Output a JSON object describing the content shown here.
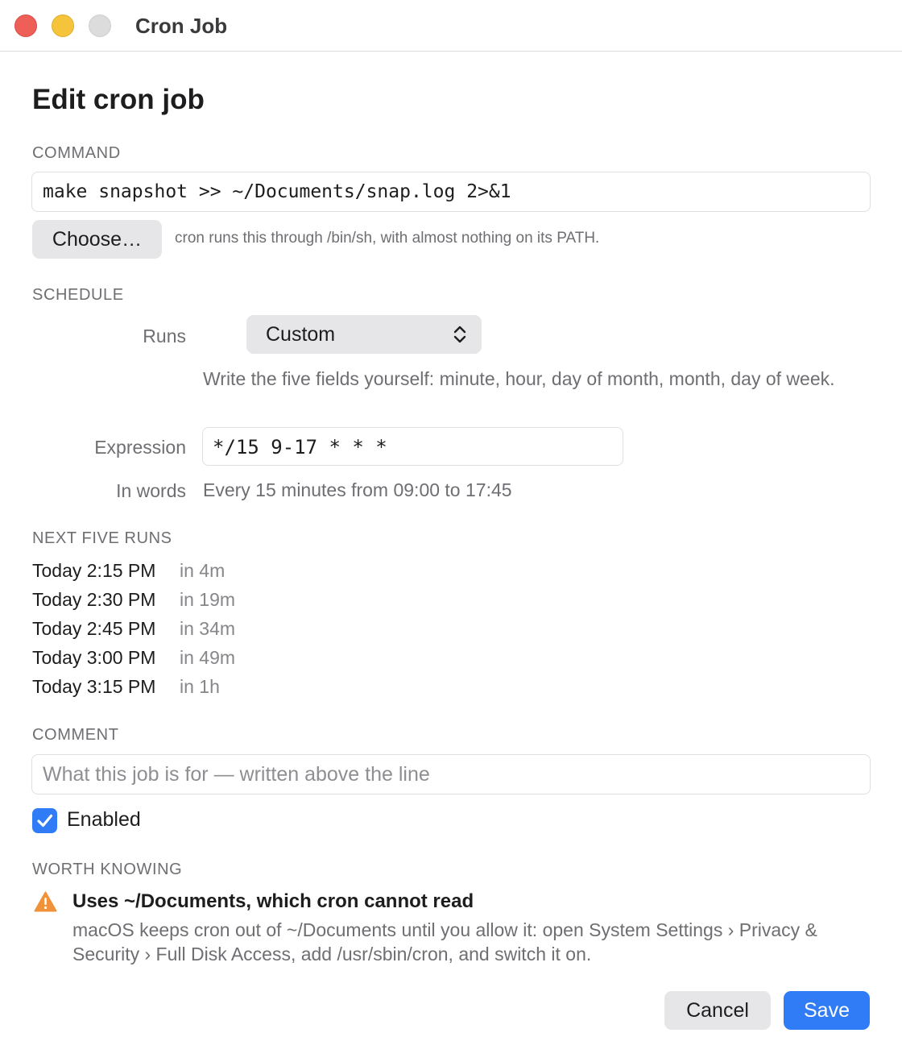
{
  "window": {
    "title": "Cron Job"
  },
  "heading": "Edit cron job",
  "command": {
    "label": "COMMAND",
    "value": "make snapshot >> ~/Documents/snap.log 2>&1",
    "choose_label": "Choose…",
    "hint": "cron runs this through /bin/sh, with almost nothing on its PATH."
  },
  "schedule": {
    "label": "SCHEDULE",
    "runs_label": "Runs",
    "runs_value": "Custom",
    "description": "Write the five fields yourself: minute, hour, day of month, month, day of week.",
    "expression_label": "Expression",
    "expression_value": "*/15 9-17 * * *",
    "in_words_label": "In words",
    "in_words_value": "Every 15 minutes from 09:00 to 17:45"
  },
  "next_runs": {
    "label": "NEXT FIVE RUNS",
    "items": [
      {
        "time": "Today 2:15 PM",
        "relative": "in 4m"
      },
      {
        "time": "Today 2:30 PM",
        "relative": "in 19m"
      },
      {
        "time": "Today 2:45 PM",
        "relative": "in 34m"
      },
      {
        "time": "Today 3:00 PM",
        "relative": "in 49m"
      },
      {
        "time": "Today 3:15 PM",
        "relative": "in 1h"
      }
    ]
  },
  "comment": {
    "label": "COMMENT",
    "placeholder": "What this job is for — written above the line",
    "value": ""
  },
  "enabled": {
    "label": "Enabled",
    "checked": true
  },
  "worth_knowing": {
    "label": "WORTH KNOWING",
    "icon": "warning-icon",
    "title": "Uses ~/Documents, which cron cannot read",
    "body": "macOS keeps cron out of ~/Documents until you allow it: open System Settings › Privacy & Security › Full Disk Access, add /usr/sbin/cron, and switch it on."
  },
  "footer": {
    "cancel_label": "Cancel",
    "save_label": "Save"
  },
  "colors": {
    "accent": "#2f7cf6",
    "warning": "#f0923a"
  }
}
